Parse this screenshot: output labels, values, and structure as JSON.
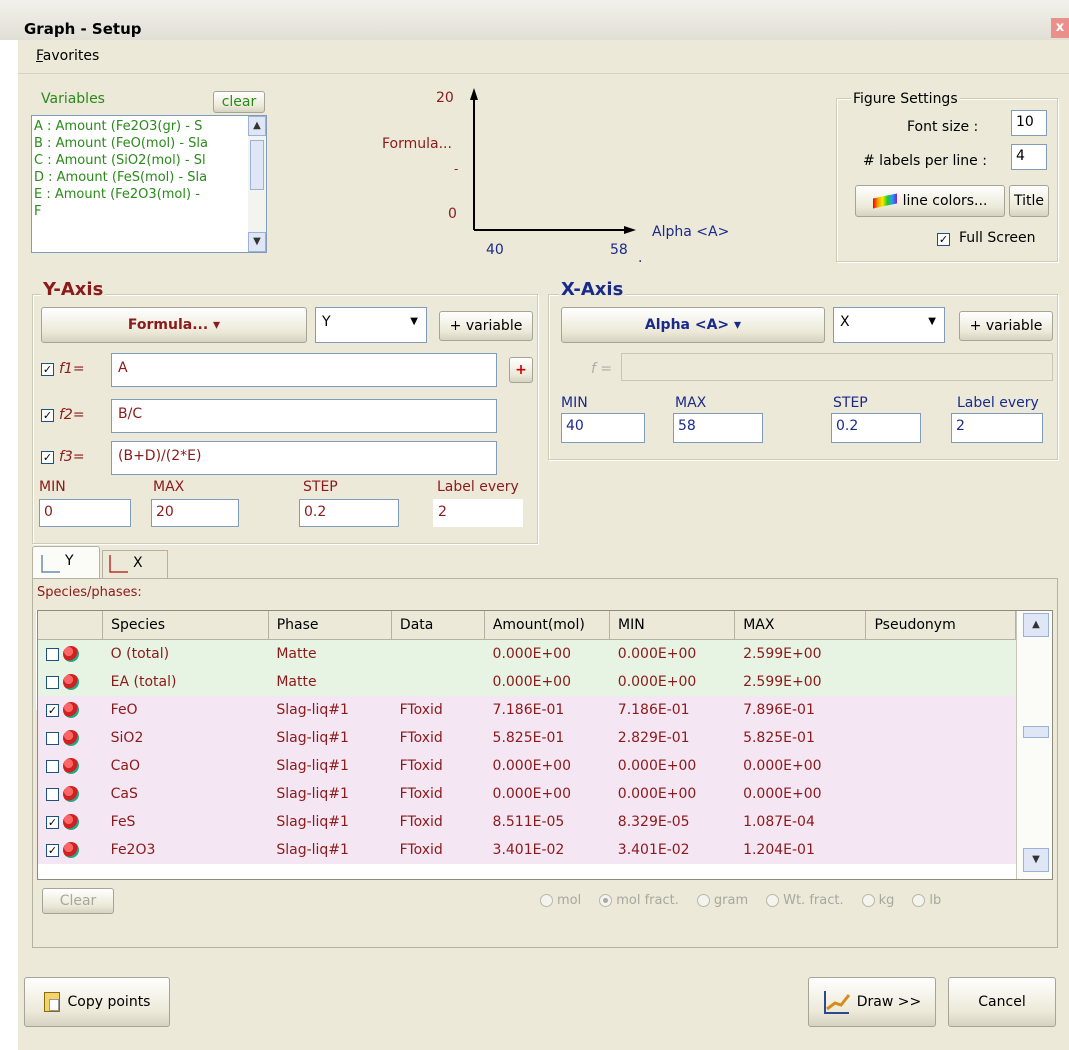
{
  "window": {
    "title": "Graph - Setup",
    "close_glyph": "x"
  },
  "menu": {
    "favorites": "Favorites"
  },
  "variables": {
    "label": "Variables",
    "clear_label": "clear",
    "items": [
      "A : Amount (Fe2O3(gr) - S",
      "B : Amount (FeO(mol) - Sla",
      "C : Amount (SiO2(mol) - Sl",
      "D : Amount (FeS(mol) - Sla",
      "E : Amount (Fe2O3(mol) -",
      "F"
    ]
  },
  "preview": {
    "y_top": "20",
    "y_label": "Formula...",
    "y_dash": "-",
    "y_bottom": "0",
    "x_left": "40",
    "x_right": "58",
    "x_label": "Alpha <A>",
    "x_dot": "."
  },
  "figure_settings": {
    "label": "Figure Settings",
    "font_size_label": "Font size :",
    "font_size_value": "10",
    "labels_per_line_label": "# labels per line :",
    "labels_per_line_value": "4",
    "line_colors_label": "line colors...",
    "title_label": "Title",
    "full_screen_label": "Full Screen",
    "full_screen_checked": "✓"
  },
  "y_axis": {
    "title": "Y-Axis",
    "formula_button": "Formula... ▾",
    "axis_select": "Y",
    "add_variable": "+ variable",
    "f1_label": "f1=",
    "f1_value": "A",
    "f2_label": "f2=",
    "f2_value": "B/C",
    "f3_label": "f3=",
    "f3_value": "(B+D)/(2*E)",
    "check": "✓",
    "plus_label": "+",
    "min_label": "MIN",
    "min_value": "0",
    "max_label": "MAX",
    "max_value": "20",
    "step_label": "STEP",
    "step_value": "0.2",
    "label_every_label": "Label every",
    "label_every_value": "2"
  },
  "x_axis": {
    "title": "X-Axis",
    "var_button": "Alpha <A> ▾",
    "axis_select": "X",
    "add_variable": "+ variable",
    "f_label": "f =",
    "f_value": "",
    "min_label": "MIN",
    "min_value": "40",
    "max_label": "MAX",
    "max_value": "58",
    "step_label": "STEP",
    "step_value": "0.2",
    "label_every_label": "Label every",
    "label_every_value": "2"
  },
  "tabs": {
    "y": "Y",
    "x": "X"
  },
  "species": {
    "label": "Species/phases:",
    "columns": [
      "Species",
      "Phase",
      "Data",
      "Amount(mol)",
      "MIN",
      "MAX",
      "Pseudonym"
    ],
    "rows": [
      {
        "checked": "",
        "species": "O (total)",
        "phase": "Matte",
        "data": "",
        "amount": "0.000E+00",
        "min": "0.000E+00",
        "max": "2.599E+00",
        "pseudonym": ""
      },
      {
        "checked": "",
        "species": "EA (total)",
        "phase": "Matte",
        "data": "",
        "amount": "0.000E+00",
        "min": "0.000E+00",
        "max": "2.599E+00",
        "pseudonym": ""
      },
      {
        "checked": "✓",
        "species": "FeO",
        "phase": "Slag-liq#1",
        "data": "FToxid",
        "amount": "7.186E-01",
        "min": "7.186E-01",
        "max": "7.896E-01",
        "pseudonym": ""
      },
      {
        "checked": "",
        "species": "SiO2",
        "phase": "Slag-liq#1",
        "data": "FToxid",
        "amount": "5.825E-01",
        "min": "2.829E-01",
        "max": "5.825E-01",
        "pseudonym": ""
      },
      {
        "checked": "",
        "species": "CaO",
        "phase": "Slag-liq#1",
        "data": "FToxid",
        "amount": "0.000E+00",
        "min": "0.000E+00",
        "max": "0.000E+00",
        "pseudonym": ""
      },
      {
        "checked": "",
        "species": "CaS",
        "phase": "Slag-liq#1",
        "data": "FToxid",
        "amount": "0.000E+00",
        "min": "0.000E+00",
        "max": "0.000E+00",
        "pseudonym": ""
      },
      {
        "checked": "✓",
        "species": "FeS",
        "phase": "Slag-liq#1",
        "data": "FToxid",
        "amount": "8.511E-05",
        "min": "8.329E-05",
        "max": "1.087E-04",
        "pseudonym": ""
      },
      {
        "checked": "✓",
        "species": "Fe2O3",
        "phase": "Slag-liq#1",
        "data": "FToxid",
        "amount": "3.401E-02",
        "min": "3.401E-02",
        "max": "1.204E-01",
        "pseudonym": ""
      }
    ],
    "clear_label": "Clear",
    "units": [
      "mol",
      "mol fract.",
      "gram",
      "Wt. fract.",
      "kg",
      "lb"
    ],
    "selected_unit": "mol fract."
  },
  "footer": {
    "copy_points": "Copy points",
    "draw": "Draw >>",
    "cancel": "Cancel"
  },
  "scroll": {
    "up": "▲",
    "down": "▼"
  }
}
